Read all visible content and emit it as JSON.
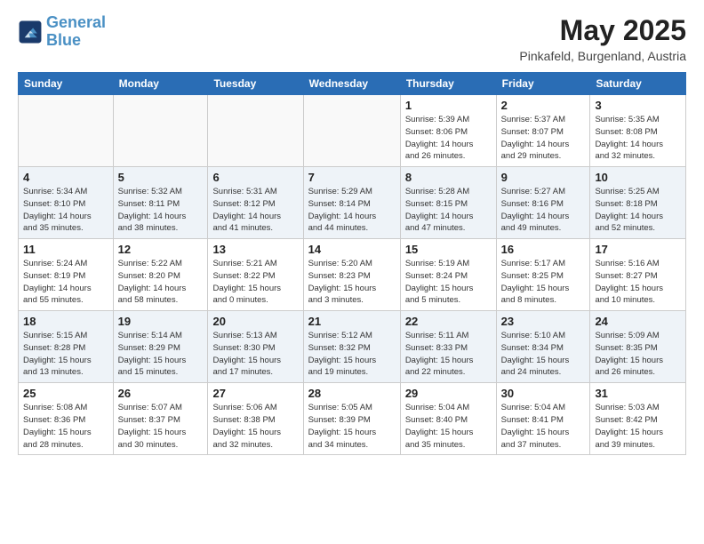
{
  "header": {
    "logo_line1": "General",
    "logo_line2": "Blue",
    "month_title": "May 2025",
    "location": "Pinkafeld, Burgenland, Austria"
  },
  "days_of_week": [
    "Sunday",
    "Monday",
    "Tuesday",
    "Wednesday",
    "Thursday",
    "Friday",
    "Saturday"
  ],
  "weeks": [
    [
      {
        "num": "",
        "info": ""
      },
      {
        "num": "",
        "info": ""
      },
      {
        "num": "",
        "info": ""
      },
      {
        "num": "",
        "info": ""
      },
      {
        "num": "1",
        "info": "Sunrise: 5:39 AM\nSunset: 8:06 PM\nDaylight: 14 hours\nand 26 minutes."
      },
      {
        "num": "2",
        "info": "Sunrise: 5:37 AM\nSunset: 8:07 PM\nDaylight: 14 hours\nand 29 minutes."
      },
      {
        "num": "3",
        "info": "Sunrise: 5:35 AM\nSunset: 8:08 PM\nDaylight: 14 hours\nand 32 minutes."
      }
    ],
    [
      {
        "num": "4",
        "info": "Sunrise: 5:34 AM\nSunset: 8:10 PM\nDaylight: 14 hours\nand 35 minutes."
      },
      {
        "num": "5",
        "info": "Sunrise: 5:32 AM\nSunset: 8:11 PM\nDaylight: 14 hours\nand 38 minutes."
      },
      {
        "num": "6",
        "info": "Sunrise: 5:31 AM\nSunset: 8:12 PM\nDaylight: 14 hours\nand 41 minutes."
      },
      {
        "num": "7",
        "info": "Sunrise: 5:29 AM\nSunset: 8:14 PM\nDaylight: 14 hours\nand 44 minutes."
      },
      {
        "num": "8",
        "info": "Sunrise: 5:28 AM\nSunset: 8:15 PM\nDaylight: 14 hours\nand 47 minutes."
      },
      {
        "num": "9",
        "info": "Sunrise: 5:27 AM\nSunset: 8:16 PM\nDaylight: 14 hours\nand 49 minutes."
      },
      {
        "num": "10",
        "info": "Sunrise: 5:25 AM\nSunset: 8:18 PM\nDaylight: 14 hours\nand 52 minutes."
      }
    ],
    [
      {
        "num": "11",
        "info": "Sunrise: 5:24 AM\nSunset: 8:19 PM\nDaylight: 14 hours\nand 55 minutes."
      },
      {
        "num": "12",
        "info": "Sunrise: 5:22 AM\nSunset: 8:20 PM\nDaylight: 14 hours\nand 58 minutes."
      },
      {
        "num": "13",
        "info": "Sunrise: 5:21 AM\nSunset: 8:22 PM\nDaylight: 15 hours\nand 0 minutes."
      },
      {
        "num": "14",
        "info": "Sunrise: 5:20 AM\nSunset: 8:23 PM\nDaylight: 15 hours\nand 3 minutes."
      },
      {
        "num": "15",
        "info": "Sunrise: 5:19 AM\nSunset: 8:24 PM\nDaylight: 15 hours\nand 5 minutes."
      },
      {
        "num": "16",
        "info": "Sunrise: 5:17 AM\nSunset: 8:25 PM\nDaylight: 15 hours\nand 8 minutes."
      },
      {
        "num": "17",
        "info": "Sunrise: 5:16 AM\nSunset: 8:27 PM\nDaylight: 15 hours\nand 10 minutes."
      }
    ],
    [
      {
        "num": "18",
        "info": "Sunrise: 5:15 AM\nSunset: 8:28 PM\nDaylight: 15 hours\nand 13 minutes."
      },
      {
        "num": "19",
        "info": "Sunrise: 5:14 AM\nSunset: 8:29 PM\nDaylight: 15 hours\nand 15 minutes."
      },
      {
        "num": "20",
        "info": "Sunrise: 5:13 AM\nSunset: 8:30 PM\nDaylight: 15 hours\nand 17 minutes."
      },
      {
        "num": "21",
        "info": "Sunrise: 5:12 AM\nSunset: 8:32 PM\nDaylight: 15 hours\nand 19 minutes."
      },
      {
        "num": "22",
        "info": "Sunrise: 5:11 AM\nSunset: 8:33 PM\nDaylight: 15 hours\nand 22 minutes."
      },
      {
        "num": "23",
        "info": "Sunrise: 5:10 AM\nSunset: 8:34 PM\nDaylight: 15 hours\nand 24 minutes."
      },
      {
        "num": "24",
        "info": "Sunrise: 5:09 AM\nSunset: 8:35 PM\nDaylight: 15 hours\nand 26 minutes."
      }
    ],
    [
      {
        "num": "25",
        "info": "Sunrise: 5:08 AM\nSunset: 8:36 PM\nDaylight: 15 hours\nand 28 minutes."
      },
      {
        "num": "26",
        "info": "Sunrise: 5:07 AM\nSunset: 8:37 PM\nDaylight: 15 hours\nand 30 minutes."
      },
      {
        "num": "27",
        "info": "Sunrise: 5:06 AM\nSunset: 8:38 PM\nDaylight: 15 hours\nand 32 minutes."
      },
      {
        "num": "28",
        "info": "Sunrise: 5:05 AM\nSunset: 8:39 PM\nDaylight: 15 hours\nand 34 minutes."
      },
      {
        "num": "29",
        "info": "Sunrise: 5:04 AM\nSunset: 8:40 PM\nDaylight: 15 hours\nand 35 minutes."
      },
      {
        "num": "30",
        "info": "Sunrise: 5:04 AM\nSunset: 8:41 PM\nDaylight: 15 hours\nand 37 minutes."
      },
      {
        "num": "31",
        "info": "Sunrise: 5:03 AM\nSunset: 8:42 PM\nDaylight: 15 hours\nand 39 minutes."
      }
    ]
  ]
}
